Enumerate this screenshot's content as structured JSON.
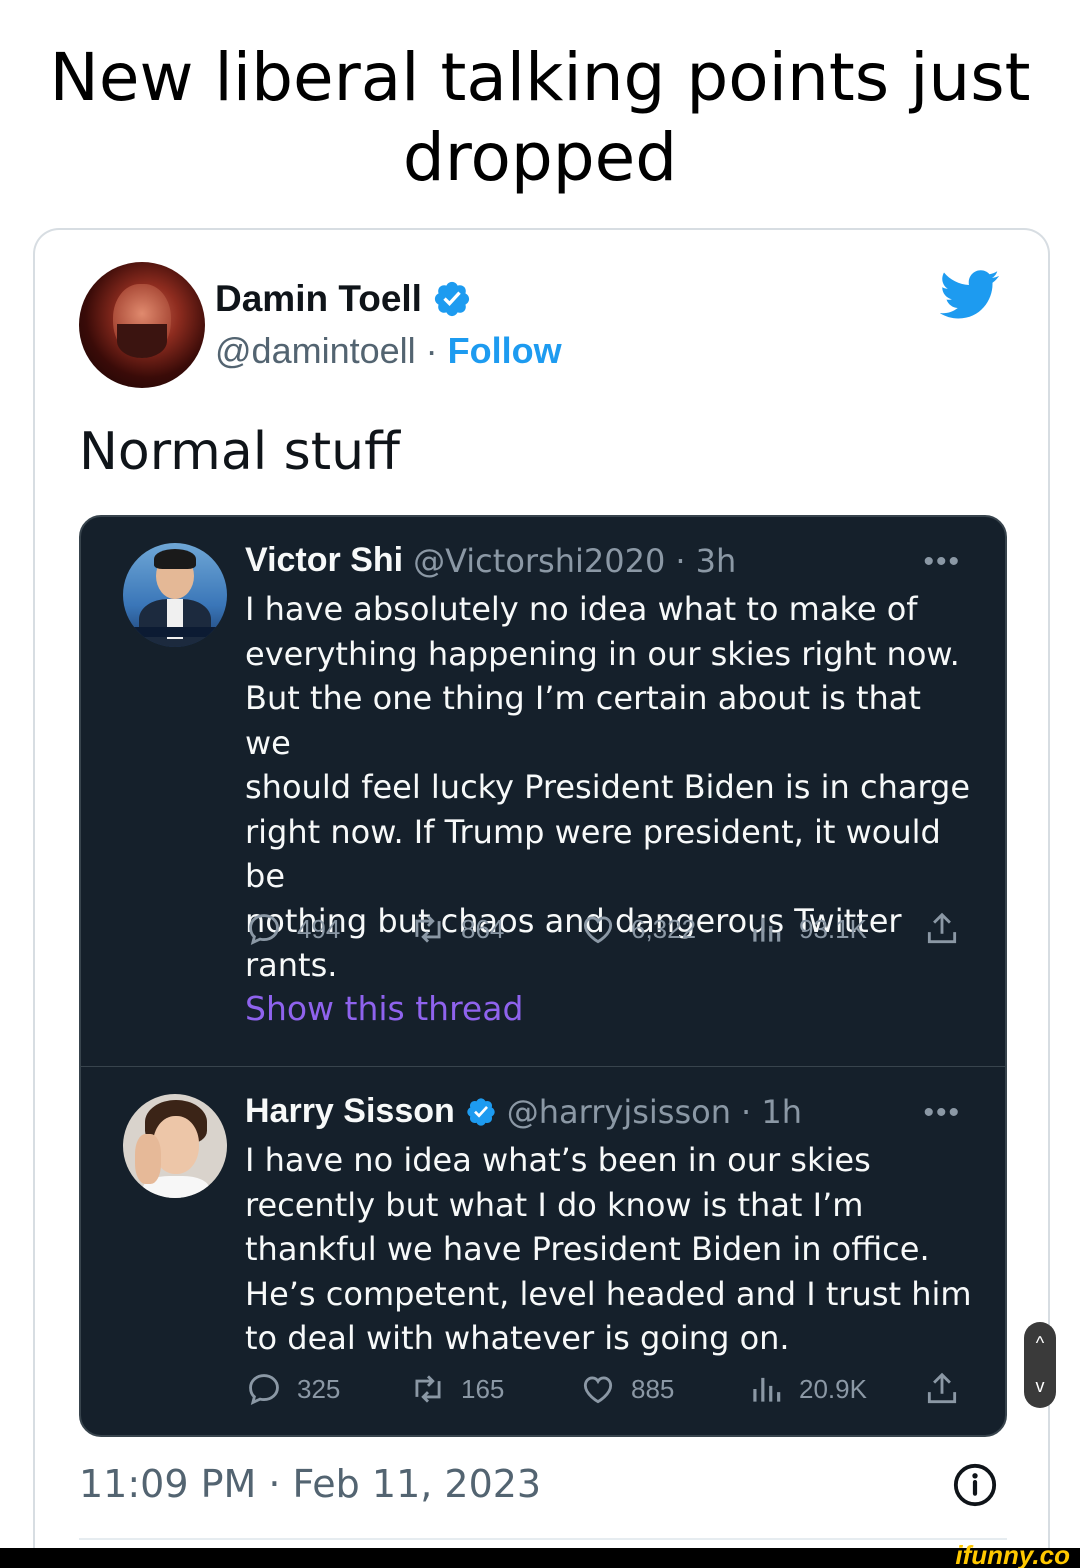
{
  "caption": {
    "line1": "New liberal talking points just",
    "line2": "dropped"
  },
  "tweet": {
    "author_name": "Damin Toell",
    "author_handle": "@damintoell",
    "separator": " · ",
    "follow_label": "Follow",
    "text": "Normal stuff",
    "timestamp": "11:09 PM · Feb 11, 2023"
  },
  "embedded": [
    {
      "name": "Victor Shi",
      "handle": "@Victorshi2020",
      "time": "· 3h",
      "more": "•••",
      "body_lines": [
        "I have absolutely no idea what to make of",
        "everything happening in our skies right now.",
        "But the one thing I’m certain about is that we",
        "should feel lucky President Biden is in charge",
        "right now. If Trump were president, it would be",
        "nothing but chaos and dangerous Twitter",
        "rants."
      ],
      "replies": "494",
      "retweets": "864",
      "likes": "6,322",
      "views": "93.1K",
      "show_thread": "Show this thread"
    },
    {
      "name": "Harry Sisson",
      "handle": "@harryjsisson",
      "time": "· 1h",
      "more": "•••",
      "body_lines": [
        "I have no idea what’s been in our skies",
        "recently but what I do know is that I’m",
        "thankful we have President Biden in office.",
        "He’s competent, level headed and I trust him",
        "to deal with whatever is going on."
      ],
      "replies": "325",
      "retweets": "165",
      "likes": "885",
      "views": "20.9K"
    }
  ],
  "scroll": {
    "up": "^",
    "down": "v"
  },
  "watermark": "ifunny.co",
  "colors": {
    "twitter_blue": "#1d9bf0",
    "dark_bg": "#15202b",
    "thread_purple": "#8f63ee"
  },
  "icons": [
    "twitter-bird-icon",
    "verified-badge-icon",
    "reply-icon",
    "retweet-icon",
    "like-icon",
    "views-icon",
    "share-icon",
    "info-icon"
  ]
}
